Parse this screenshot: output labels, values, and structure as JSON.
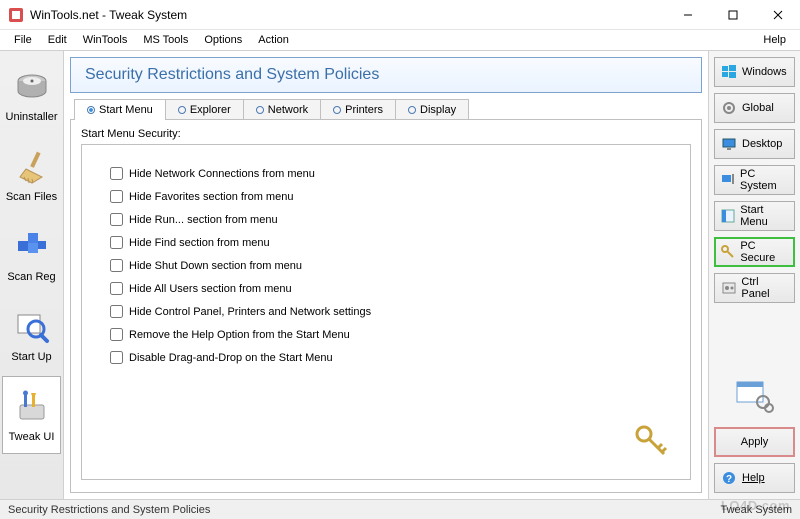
{
  "window": {
    "title": "WinTools.net - Tweak System",
    "min": "—",
    "max": "☐",
    "close": "✕"
  },
  "menu": {
    "file": "File",
    "edit": "Edit",
    "wintools": "WinTools",
    "mstools": "MS Tools",
    "options": "Options",
    "action": "Action",
    "help": "Help"
  },
  "left": {
    "uninstaller": "Uninstaller",
    "scanfiles": "Scan Files",
    "scanreg": "Scan Reg",
    "startup": "Start Up",
    "tweakui": "Tweak UI"
  },
  "header": {
    "title": "Security Restrictions and System Policies"
  },
  "tabs": {
    "startmenu": "Start Menu",
    "explorer": "Explorer",
    "network": "Network",
    "printers": "Printers",
    "display": "Display"
  },
  "group": {
    "label": "Start Menu Security:"
  },
  "options": [
    "Hide Network Connections from menu",
    "Hide Favorites section from menu",
    "Hide Run... section from menu",
    "Hide Find section from menu",
    "Hide Shut Down section from menu",
    "Hide All Users section from menu",
    "Hide Control Panel, Printers and Network settings",
    "Remove the Help Option from the Start Menu",
    "Disable Drag-and-Drop on the Start Menu"
  ],
  "right": {
    "windows": "Windows",
    "global": "Global",
    "desktop": "Desktop",
    "pcsystem": "PC System",
    "startmenu": "Start Menu",
    "pcsecure": "PC Secure",
    "ctrlpanel": "Ctrl Panel",
    "apply": "Apply",
    "help": "Help"
  },
  "status": {
    "left": "Security Restrictions and System Policies",
    "right": "Tweak System"
  },
  "watermark": "LO4D.com"
}
